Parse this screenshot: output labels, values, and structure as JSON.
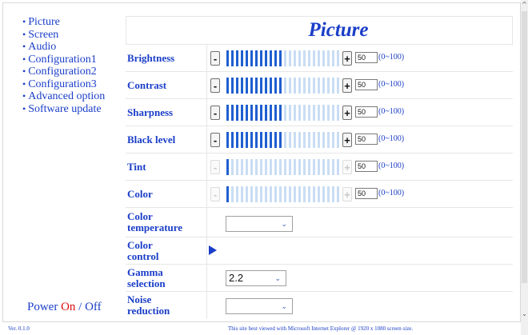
{
  "menu": {
    "items": [
      {
        "label": "Picture"
      },
      {
        "label": "Screen"
      },
      {
        "label": "Audio"
      },
      {
        "label": "Configuration1"
      },
      {
        "label": "Configuration2"
      },
      {
        "label": "Configuration3"
      },
      {
        "label": "Advanced option"
      },
      {
        "label": "Software update"
      }
    ]
  },
  "power": {
    "label": "Power",
    "on": "On",
    "separator": "/",
    "off": "Off"
  },
  "page_title": "Picture",
  "sliders": [
    {
      "label": "Brightness",
      "value": "50",
      "range": "(0~100)",
      "level": 0.5,
      "enabled": true,
      "minus": "-",
      "plus": "+"
    },
    {
      "label": "Contrast",
      "value": "50",
      "range": "(0~100)",
      "level": 0.5,
      "enabled": true,
      "minus": "-",
      "plus": "+"
    },
    {
      "label": "Sharpness",
      "value": "50",
      "range": "(0~100)",
      "level": 0.5,
      "enabled": true,
      "minus": "-",
      "plus": "+"
    },
    {
      "label": "Black level",
      "value": "50",
      "range": "(0~100)",
      "level": 0.5,
      "enabled": true,
      "minus": "-",
      "plus": "+"
    },
    {
      "label": "Tint",
      "value": "50",
      "range": "(0~100)",
      "level": 0.0,
      "enabled": false,
      "minus": "-",
      "plus": "+"
    },
    {
      "label": "Color",
      "value": "50",
      "range": "(0~100)",
      "level": 0.0,
      "enabled": false,
      "minus": "-",
      "plus": "+"
    }
  ],
  "color_temperature": {
    "label_line1": "Color",
    "label_line2": "temperature",
    "value": ""
  },
  "color_control": {
    "label_line1": "Color",
    "label_line2": "control"
  },
  "gamma": {
    "label_line1": "Gamma",
    "label_line2": "selection",
    "value": "2.2"
  },
  "noise": {
    "label_line1": "Noise",
    "label_line2": "reduction",
    "value": ""
  },
  "footer": {
    "version": "Ver. 0.1.0",
    "note": "This site best viewed with Microsoft Internet Explorer @ 1920 x 1080 screen size."
  },
  "colors": {
    "accent": "#1a3ec8",
    "bar_fill": "#1f5fd0",
    "bar_empty": "#c9ddf4",
    "power_on": "#e01010"
  }
}
